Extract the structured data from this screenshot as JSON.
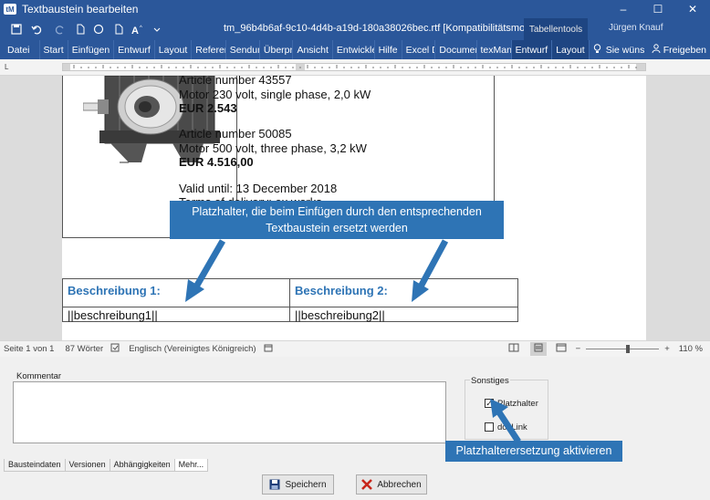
{
  "window": {
    "title": "Textbaustein bearbeiten",
    "app_icon": "tM",
    "controls": [
      "–",
      "☐",
      "✕"
    ]
  },
  "word": {
    "doc_title": "tm_96b4b6af-9c10-4d4b-a19d-180a38026bec.rtf [Kompatibilitätsmodus]  -  Word",
    "context_tab": "Tabellentools",
    "user": "Jürgen Knauf",
    "tabs": [
      "Datei",
      "Start",
      "Einfügen",
      "Entwurf",
      "Layout",
      "Referenzen",
      "Sendungen",
      "Überprüfen",
      "Ansicht",
      "Entwicklertools",
      "Hilfe",
      "Excel Datei",
      "Document-Info",
      "texManager"
    ],
    "context_tabs": [
      "Entwurf",
      "Layout"
    ],
    "tell_me": "Sie wünschen...",
    "share": "Freigeben"
  },
  "document": {
    "lines": [
      {
        "text": "Article number 43557",
        "bold": false
      },
      {
        "text": "Motor 230 volt, single phase, 2,0 kW",
        "bold": false
      },
      {
        "text": "EUR 2.543",
        "bold": true
      },
      {
        "text": "Article number 50085",
        "bold": false
      },
      {
        "text": "Motor 500 volt, three phase, 3,2  kW",
        "bold": false
      },
      {
        "text": "EUR 4.516,00",
        "bold": true
      },
      {
        "text": "Valid until: 13 December 2018",
        "bold": false
      },
      {
        "text": "Terms of delivery: ex works",
        "bold": false
      }
    ],
    "desc_header_1": "Beschreibung 1:",
    "desc_header_2": "Beschreibung 2:",
    "placeholder_1": "||beschreibung1||",
    "placeholder_2": "||beschreibung2||"
  },
  "callouts": {
    "top": "Platzhalter, die beim Einfügen durch den entsprechenden Textbaustein ersetzt werden",
    "bottom": "Platzhalterersetzung aktivieren"
  },
  "status": {
    "page": "Seite 1 von 1",
    "words": "87 Wörter",
    "language": "Englisch (Vereinigtes Königreich)",
    "zoom": "110 %"
  },
  "form": {
    "comment_label": "Kommentar",
    "group_label": "Sonstiges",
    "checkbox_placeholder": "Platzhalter",
    "checkbox_doclink": "docLink",
    "tabs": [
      "Bausteindaten",
      "Versionen",
      "Abhängigkeiten",
      "Mehr..."
    ],
    "save_label": "Speichern",
    "cancel_label": "Abbrechen"
  },
  "colors": {
    "word_blue": "#2b579a",
    "callout_blue": "#2e74b5",
    "heading_blue": "#2e74b5"
  }
}
